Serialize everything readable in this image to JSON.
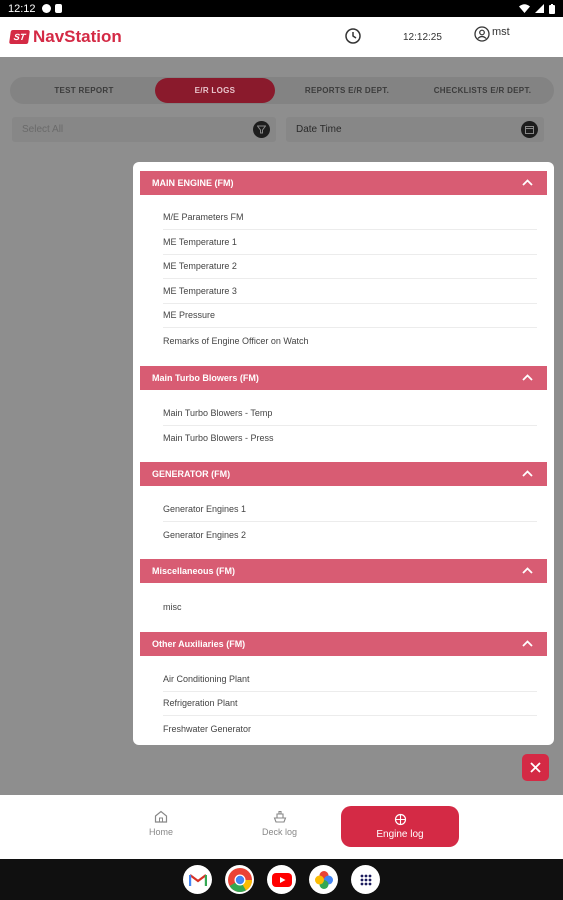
{
  "status_bar": {
    "time": "12:12"
  },
  "header": {
    "logo_badge": "ST",
    "app_name": "NavStation",
    "time": "12:12:25",
    "user": "mst"
  },
  "tabs": [
    {
      "label": "TEST REPORT"
    },
    {
      "label": "E/R LOGS"
    },
    {
      "label": "REPORTS E/R DEPT."
    },
    {
      "label": "CHECKLISTS E/R DEPT."
    }
  ],
  "filters": {
    "select_all": "Select All",
    "date_time": "Date Time"
  },
  "sections": [
    {
      "title": "MAIN ENGINE (FM)",
      "items": [
        "M/E Parameters FM",
        "ME Temperature 1",
        "ME Temperature 2",
        "ME Temperature 3",
        "ME Pressure",
        "Remarks of Engine Officer on Watch"
      ]
    },
    {
      "title": "Main Turbo Blowers (FM)",
      "items": [
        "Main Turbo Blowers - Temp",
        "Main Turbo Blowers - Press"
      ]
    },
    {
      "title": "GENERATOR (FM)",
      "items": [
        "Generator Engines 1",
        "Generator Engines 2"
      ]
    },
    {
      "title": "Miscellaneous (FM)",
      "items": [
        "misc"
      ]
    },
    {
      "title": "Other Auxiliaries (FM)",
      "items": [
        "Air Conditioning Plant",
        "Refrigeration Plant",
        "Freshwater Generator"
      ]
    }
  ],
  "bottom_nav": {
    "home": "Home",
    "deck_log": "Deck log",
    "engine_log": "Engine log"
  },
  "colors": {
    "brand": "#d42a45",
    "section_header": "#d85c73",
    "overlay": "#8e8e8e"
  }
}
